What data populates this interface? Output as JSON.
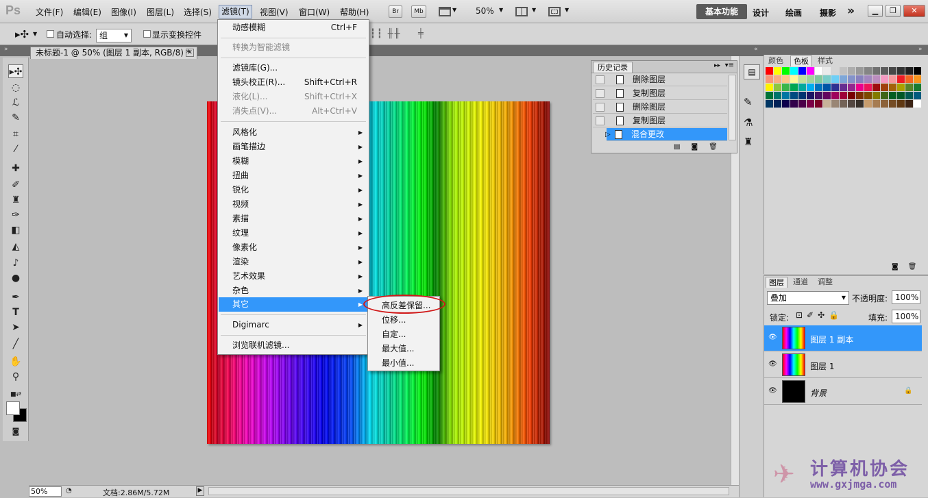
{
  "app": {
    "logo": "Ps"
  },
  "menubar": {
    "items": [
      "文件(F)",
      "编辑(E)",
      "图像(I)",
      "图层(L)",
      "选择(S)",
      "滤镜(T)",
      "视图(V)",
      "窗口(W)",
      "帮助(H)"
    ],
    "bridge": "Br",
    "minibridge": "Mb",
    "zoom": "50%",
    "workspaces": [
      "基本功能",
      "设计",
      "绘画",
      "摄影"
    ],
    "more": "»"
  },
  "options": {
    "auto_select_label": "自动选择:",
    "auto_select_value": "组",
    "show_transform_label": "显示变换控件"
  },
  "document": {
    "tab_title": "未标题-1 @ 50% (图层 1 副本, RGB/8) *"
  },
  "filter_menu": {
    "last_filter": "动感模糊",
    "last_filter_sc": "Ctrl+F",
    "convert_smart": "转换为智能滤镜",
    "gallery": "滤镜库(G)...",
    "lens": "镜头校正(R)...",
    "lens_sc": "Shift+Ctrl+R",
    "liquify": "液化(L)...",
    "liquify_sc": "Shift+Ctrl+X",
    "vanish": "消失点(V)...",
    "vanish_sc": "Alt+Ctrl+V",
    "groups": [
      "风格化",
      "画笔描边",
      "模糊",
      "扭曲",
      "锐化",
      "视频",
      "素描",
      "纹理",
      "像素化",
      "渲染",
      "艺术效果",
      "杂色",
      "其它"
    ],
    "digimarc": "Digimarc",
    "browse": "浏览联机滤镜..."
  },
  "sub_menu": {
    "items": [
      "高反差保留...",
      "位移...",
      "自定...",
      "最大值...",
      "最小值..."
    ]
  },
  "history": {
    "title": "历史记录",
    "rows": [
      "删除图层",
      "复制图层",
      "删除图层",
      "复制图层",
      "混合更改"
    ]
  },
  "swatches": {
    "tabs": [
      "颜色",
      "色板",
      "样式"
    ],
    "colors": [
      "#ff0000",
      "#ffff00",
      "#00ff00",
      "#00ffff",
      "#0000ff",
      "#ff00ff",
      "#ffffff",
      "#ebebeb",
      "#d6d6d6",
      "#c2c2c2",
      "#adadad",
      "#999999",
      "#858585",
      "#707070",
      "#5c5c5c",
      "#474747",
      "#333333",
      "#1f1f1f",
      "#000000",
      "#f7977a",
      "#f9ad81",
      "#fdc68a",
      "#fff79a",
      "#c4df9b",
      "#a2d39c",
      "#82ca9d",
      "#7bcdc8",
      "#6ecff6",
      "#7ea7d8",
      "#8493ca",
      "#8882be",
      "#a187be",
      "#bc8dbf",
      "#f49ac2",
      "#f6989d",
      "#ed1c24",
      "#f26522",
      "#f7941d",
      "#fff200",
      "#8dc63f",
      "#39b54a",
      "#00a651",
      "#00a99d",
      "#00aeef",
      "#0072bc",
      "#0054a6",
      "#2e3192",
      "#662d91",
      "#92278f",
      "#ec008c",
      "#ed145b",
      "#9e0b0f",
      "#a0410d",
      "#a36209",
      "#aba000",
      "#598527",
      "#197b30",
      "#007236",
      "#00746b",
      "#0076a3",
      "#004b80",
      "#003471",
      "#1b1464",
      "#440e62",
      "#630460",
      "#9e005d",
      "#9e0039",
      "#790000",
      "#7b2e00",
      "#7d4900",
      "#827b00",
      "#406618",
      "#005e20",
      "#005826",
      "#005952",
      "#005b7f",
      "#003663",
      "#002157",
      "#0d004c",
      "#32004b",
      "#4b0049",
      "#7b0046",
      "#7a0026",
      "#c7b299",
      "#998675",
      "#736357",
      "#534741",
      "#37302a",
      "#c69c6d",
      "#a67c52",
      "#8c6239",
      "#754c24",
      "#603913",
      "#3c2415",
      "#ffffff"
    ]
  },
  "layers": {
    "tabs": [
      "图层",
      "通道",
      "调整"
    ],
    "blend_mode": "叠加",
    "opacity_label": "不透明度:",
    "opacity": "100%",
    "lock_label": "锁定:",
    "fill_label": "填充:",
    "fill": "100%",
    "rows": [
      "图层 1 副本",
      "图层 1",
      "背景"
    ]
  },
  "status": {
    "zoom": "50%",
    "doc": "文档:2.86M/5.72M"
  },
  "watermark": {
    "name": "计算机协会",
    "url": "www.gxjmga.com"
  }
}
